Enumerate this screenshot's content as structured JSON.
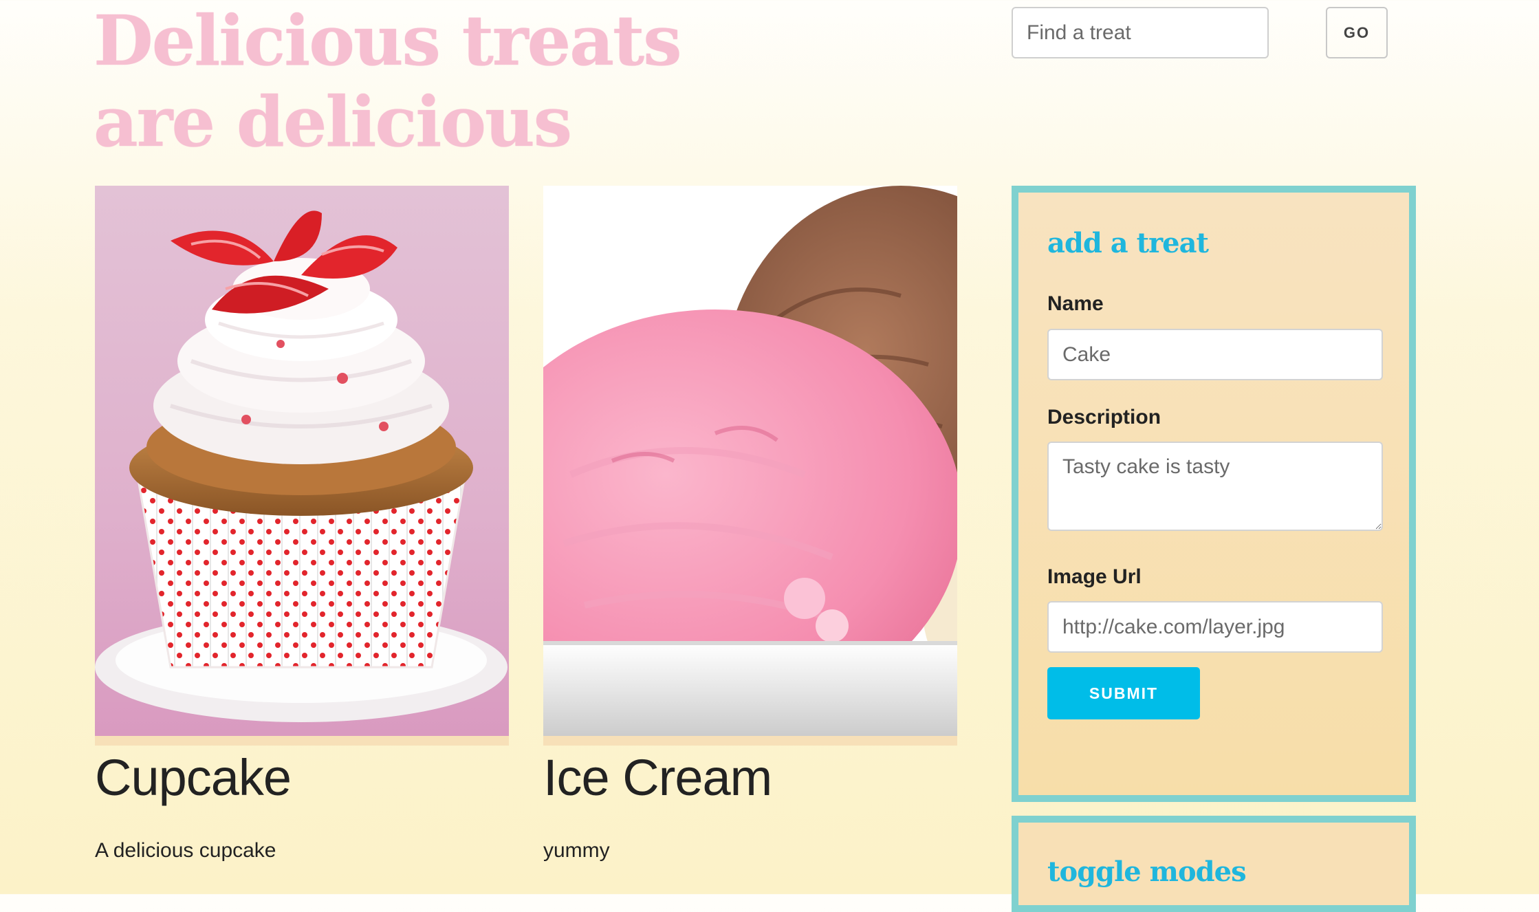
{
  "header": {
    "title": "Delicious treats are delicious",
    "search_placeholder": "Find a treat",
    "go_label": "GO"
  },
  "treats": [
    {
      "name": "Cupcake",
      "description": "A delicious cupcake",
      "image_subject": "strawberry cupcake with whipped frosting in red polka-dot paper liner on a plate"
    },
    {
      "name": "Ice Cream",
      "description": "yummy",
      "image_subject": "pink strawberry and brown chocolate ice cream scoops in a white dish"
    }
  ],
  "add_treat_form": {
    "title": "add a treat",
    "name_label": "Name",
    "name_placeholder": "Cake",
    "description_label": "Description",
    "description_placeholder": "Tasty cake is tasty",
    "image_url_label": "Image Url",
    "image_url_placeholder": "http://cake.com/layer.jpg",
    "submit_label": "SUBMIT"
  },
  "toggle_modes": {
    "title": "toggle modes"
  },
  "colors": {
    "title_pink": "#f6bfd1",
    "accent_cyan": "#00bde8",
    "panel_border": "#7fd1cf",
    "panel_background": "#f8e0b6",
    "page_background": "#fcf2c8"
  }
}
